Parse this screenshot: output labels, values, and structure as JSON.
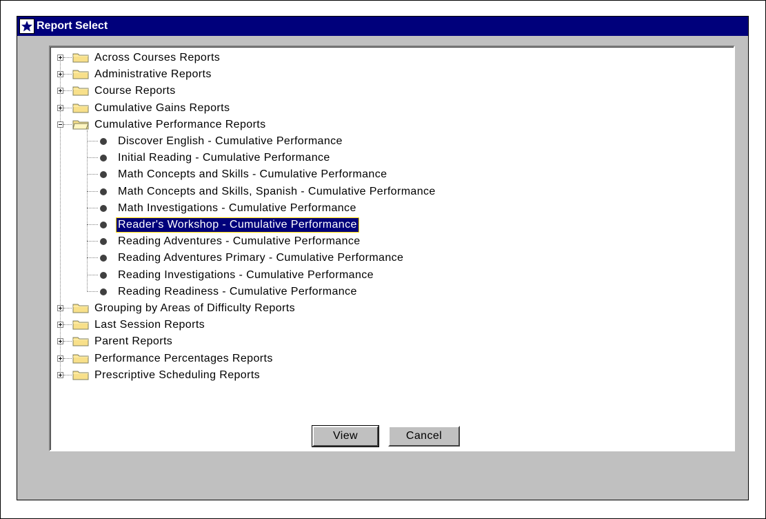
{
  "window": {
    "title": "Report Select"
  },
  "tree": {
    "top_folders_before": [
      "Across Courses Reports",
      "Administrative Reports",
      "Course Reports",
      "Cumulative Gains Reports"
    ],
    "expanded_folder": {
      "label": "Cumulative Performance Reports",
      "items": [
        "Discover English - Cumulative Performance",
        "Initial Reading - Cumulative Performance",
        "Math Concepts and Skills - Cumulative Performance",
        "Math Concepts and Skills, Spanish - Cumulative Performance",
        "Math Investigations - Cumulative Performance",
        "Reader's Workshop - Cumulative Performance",
        "Reading Adventures - Cumulative Performance",
        "Reading Adventures Primary - Cumulative Performance",
        "Reading Investigations - Cumulative Performance",
        "Reading Readiness - Cumulative Performance"
      ],
      "selected_index": 5
    },
    "top_folders_after": [
      "Grouping by Areas of Difficulty Reports",
      "Last Session Reports",
      "Parent Reports",
      "Performance Percentages Reports",
      "Prescriptive Scheduling Reports"
    ]
  },
  "buttons": {
    "view": "View",
    "cancel": "Cancel"
  },
  "colors": {
    "titlebar": "#00007b",
    "selection": "#00007b",
    "folder": "#f8e08a",
    "window_bg": "#c0c0c0"
  }
}
